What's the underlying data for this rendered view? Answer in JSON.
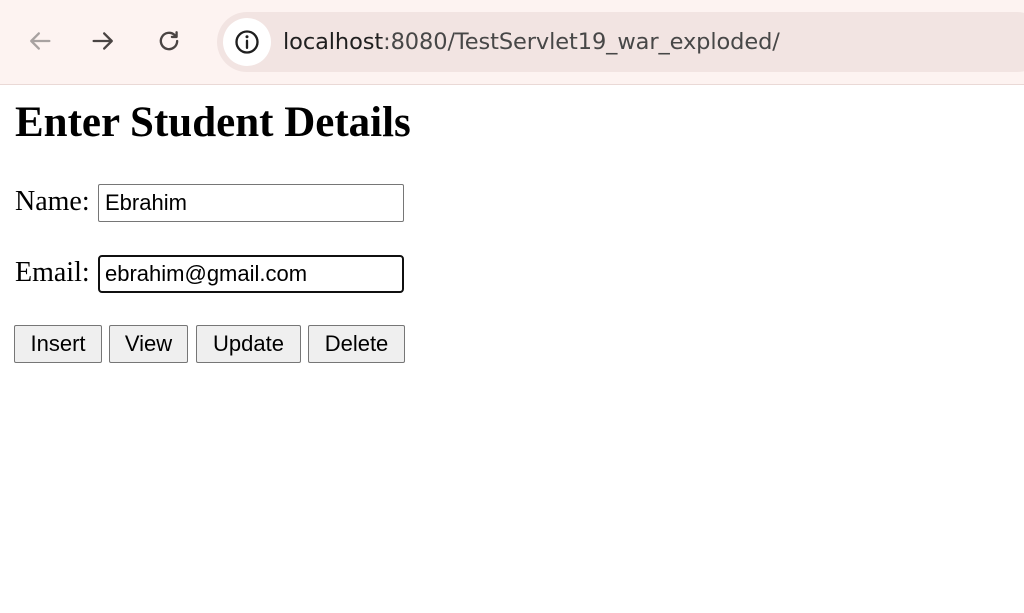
{
  "browser": {
    "url_host": "localhost",
    "url_rest": ":8080/TestServlet19_war_exploded/",
    "icons": {
      "back": "arrow-left-icon",
      "forward": "arrow-right-icon",
      "reload": "reload-icon",
      "site_info": "info-icon"
    },
    "colors": {
      "toolbar": "#fdf3f1",
      "omnibox": "#f2e4e2"
    }
  },
  "page": {
    "title": "Enter Student Details",
    "name_label": "Name:",
    "name_value": "Ebrahim",
    "email_label": "Email:",
    "email_value": "ebrahim@gmail.com",
    "buttons": {
      "insert": "Insert",
      "view": "View",
      "update": "Update",
      "delete": "Delete"
    }
  }
}
